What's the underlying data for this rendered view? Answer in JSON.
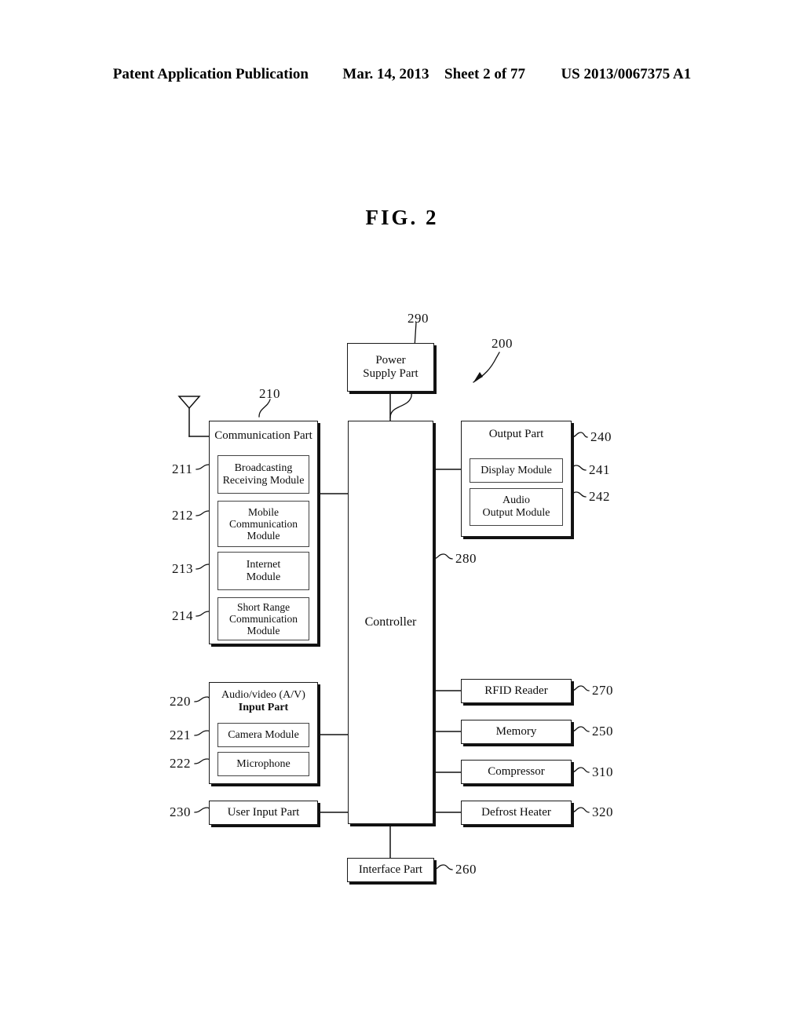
{
  "header": {
    "publication": "Patent Application Publication",
    "date": "Mar. 14, 2013",
    "sheet": "Sheet 2 of 77",
    "patent_number": "US 2013/0067375 A1"
  },
  "figure": {
    "title": "FIG. 2",
    "system_ref": "200"
  },
  "blocks": {
    "power_supply": {
      "label": "Power\nSupply Part",
      "line1": "Power",
      "line2": "Supply Part",
      "ref": "290"
    },
    "communication_part": {
      "title": "Communication Part",
      "ref": "210",
      "modules": [
        {
          "label": "Broadcasting\nReceiving Module",
          "line1": "Broadcasting",
          "line2": "Receiving Module",
          "ref": "211"
        },
        {
          "label": "Mobile Communication Module",
          "line1": "Mobile",
          "line2": "Communication",
          "line3": "Module",
          "ref": "212"
        },
        {
          "label": "Internet Module",
          "line1": "Internet",
          "line2": "Module",
          "ref": "213"
        },
        {
          "label": "Short Range Communication Module",
          "line1": "Short Range",
          "line2": "Communication",
          "line3": "Module",
          "ref": "214"
        }
      ]
    },
    "av_input_part": {
      "title_line1": "Audio/video (A/V)",
      "title_line2": "Input Part",
      "ref": "220",
      "modules": [
        {
          "label": "Camera Module",
          "ref": "221"
        },
        {
          "label": "Microphone",
          "ref": "222"
        }
      ]
    },
    "user_input_part": {
      "label": "User Input Part",
      "ref": "230"
    },
    "controller": {
      "label": "Controller",
      "ref": "280"
    },
    "output_part": {
      "title": "Output Part",
      "ref": "240",
      "modules": [
        {
          "label": "Display Module",
          "ref": "241"
        },
        {
          "label": "Audio Output Module",
          "line1": "Audio",
          "line2": "Output Module",
          "ref": "242"
        }
      ]
    },
    "rfid_reader": {
      "label": "RFID Reader",
      "ref": "270"
    },
    "memory": {
      "label": "Memory",
      "ref": "250"
    },
    "compressor": {
      "label": "Compressor",
      "ref": "310"
    },
    "defrost_heater": {
      "label": "Defrost Heater",
      "ref": "320"
    },
    "interface_part": {
      "label": "Interface Part",
      "ref": "260"
    }
  },
  "icons": {
    "antenna": "antenna-icon"
  },
  "colors": {
    "ink": "#000000",
    "paper": "#ffffff",
    "shadow": "#111111"
  }
}
